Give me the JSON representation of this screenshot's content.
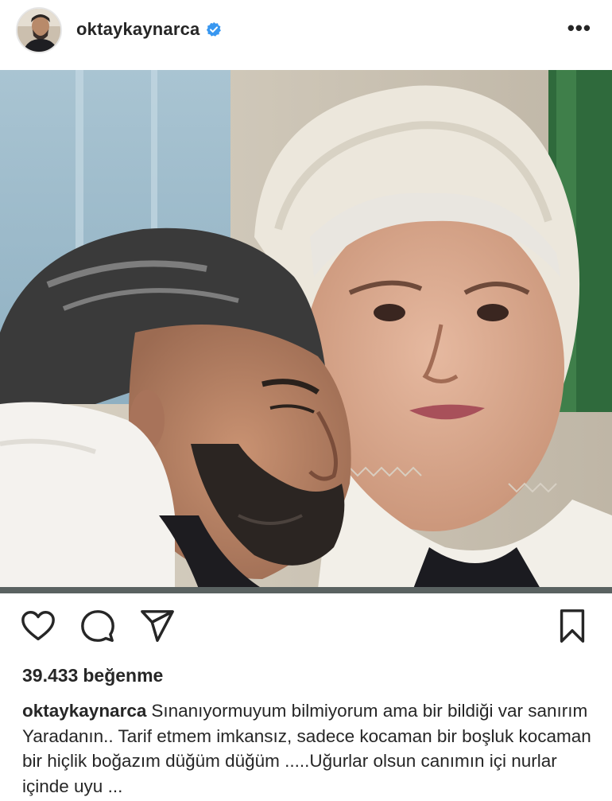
{
  "header": {
    "username": "oktaykaynarca",
    "verified_icon": "verified-badge-icon",
    "more_label": "•••",
    "colors": {
      "verified": "#3897f0"
    }
  },
  "photo": {
    "description_icon": "post-photo"
  },
  "actions": {
    "like_icon": "heart-icon",
    "comment_icon": "comment-icon",
    "share_icon": "send-icon",
    "save_icon": "bookmark-icon"
  },
  "likes": {
    "count": "39.433",
    "label": "beğenme"
  },
  "caption": {
    "username": "oktaykaynarca",
    "text": "Sınanıyormuyum bilmiyorum ama bir bildiği var sanırım Yaradanın.. Tarif etmem imkansız, sadece kocaman bir boşluk kocaman bir hiçlik boğazım düğüm düğüm .....Uğurlar olsun canımın içi nurlar içinde uyu ..."
  }
}
